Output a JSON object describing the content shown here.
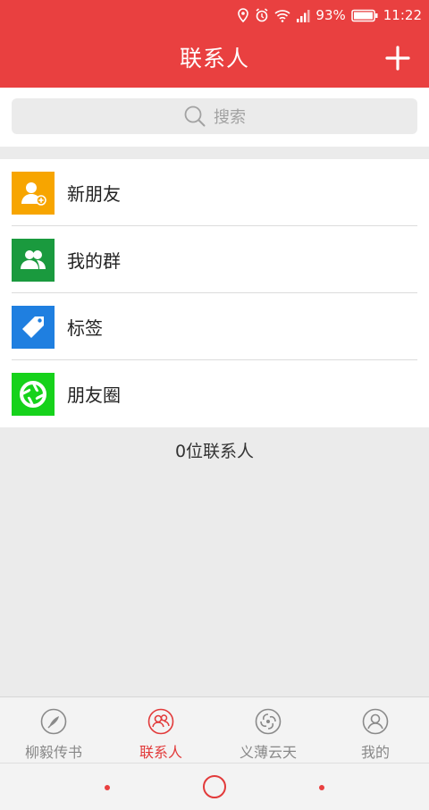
{
  "status_bar": {
    "battery": "93%",
    "time": "11:22",
    "icons": [
      "location-icon",
      "alarm-icon",
      "wifi-icon",
      "signal-icon",
      "battery-icon"
    ]
  },
  "header": {
    "title": "联系人",
    "add_icon": "plus-icon"
  },
  "search": {
    "placeholder": "搜索",
    "icon": "search-icon"
  },
  "menu": [
    {
      "label": "新朋友",
      "icon": "add-person-icon",
      "color": "#f7a500"
    },
    {
      "label": "我的群",
      "icon": "group-icon",
      "color": "#1a9a3e"
    },
    {
      "label": "标签",
      "icon": "tag-icon",
      "color": "#1f7fe0"
    },
    {
      "label": "朋友圈",
      "icon": "moments-icon",
      "color": "#16d21b"
    }
  ],
  "contact_count": "0位联系人",
  "tabs": [
    {
      "label": "柳毅传书",
      "icon": "feather-icon",
      "active": false
    },
    {
      "label": "联系人",
      "icon": "contacts-icon",
      "active": true
    },
    {
      "label": "义薄云天",
      "icon": "swirl-icon",
      "active": false
    },
    {
      "label": "我的",
      "icon": "profile-icon",
      "active": false
    }
  ],
  "colors": {
    "brand_red": "#e94040",
    "active_tab": "#e23a3a",
    "background": "#ebebeb"
  }
}
